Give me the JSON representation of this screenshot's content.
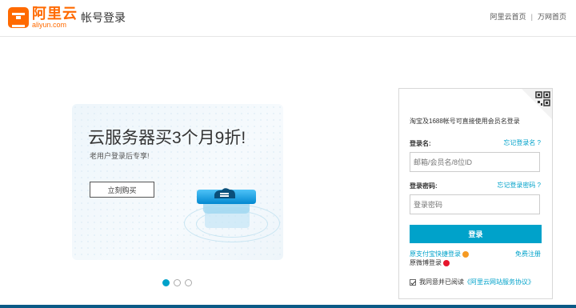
{
  "header": {
    "logo_cn": "阿里云",
    "logo_en": "aliyun.com",
    "title": "帐号登录",
    "links": [
      "阿里云首页",
      "万网首页"
    ],
    "separator": "|"
  },
  "banner": {
    "title": "云服务器买3个月9折!",
    "subtitle": "老用户登录后专享!",
    "buy_label": "立刻购买",
    "slide_count": 3,
    "active_slide": 0
  },
  "login": {
    "tip": "淘宝及1688帐号可直接使用会员名登录",
    "username_label": "登录名:",
    "forgot_username": "忘记登录名 ?",
    "username_placeholder": "邮箱/会员名/8位ID",
    "password_label": "登录密码:",
    "forgot_password": "忘记登录密码 ?",
    "password_placeholder": "登录密码",
    "submit_label": "登录",
    "alipay_login": "原支付宝快捷登录",
    "register": "免费注册",
    "weibo_login": "原微博登录",
    "agree_prefix": "我同意并已阅读",
    "agree_protocol": "《阿里云网站服务协议》",
    "agree_checked": true
  },
  "colors": {
    "brand": "#ff6a00",
    "accent": "#00a2ca",
    "bottom_bar": "#0a5a86"
  },
  "icons": [
    "logo-icon",
    "qrcode-icon",
    "alipay-icon",
    "weibo-icon",
    "server-icon"
  ]
}
